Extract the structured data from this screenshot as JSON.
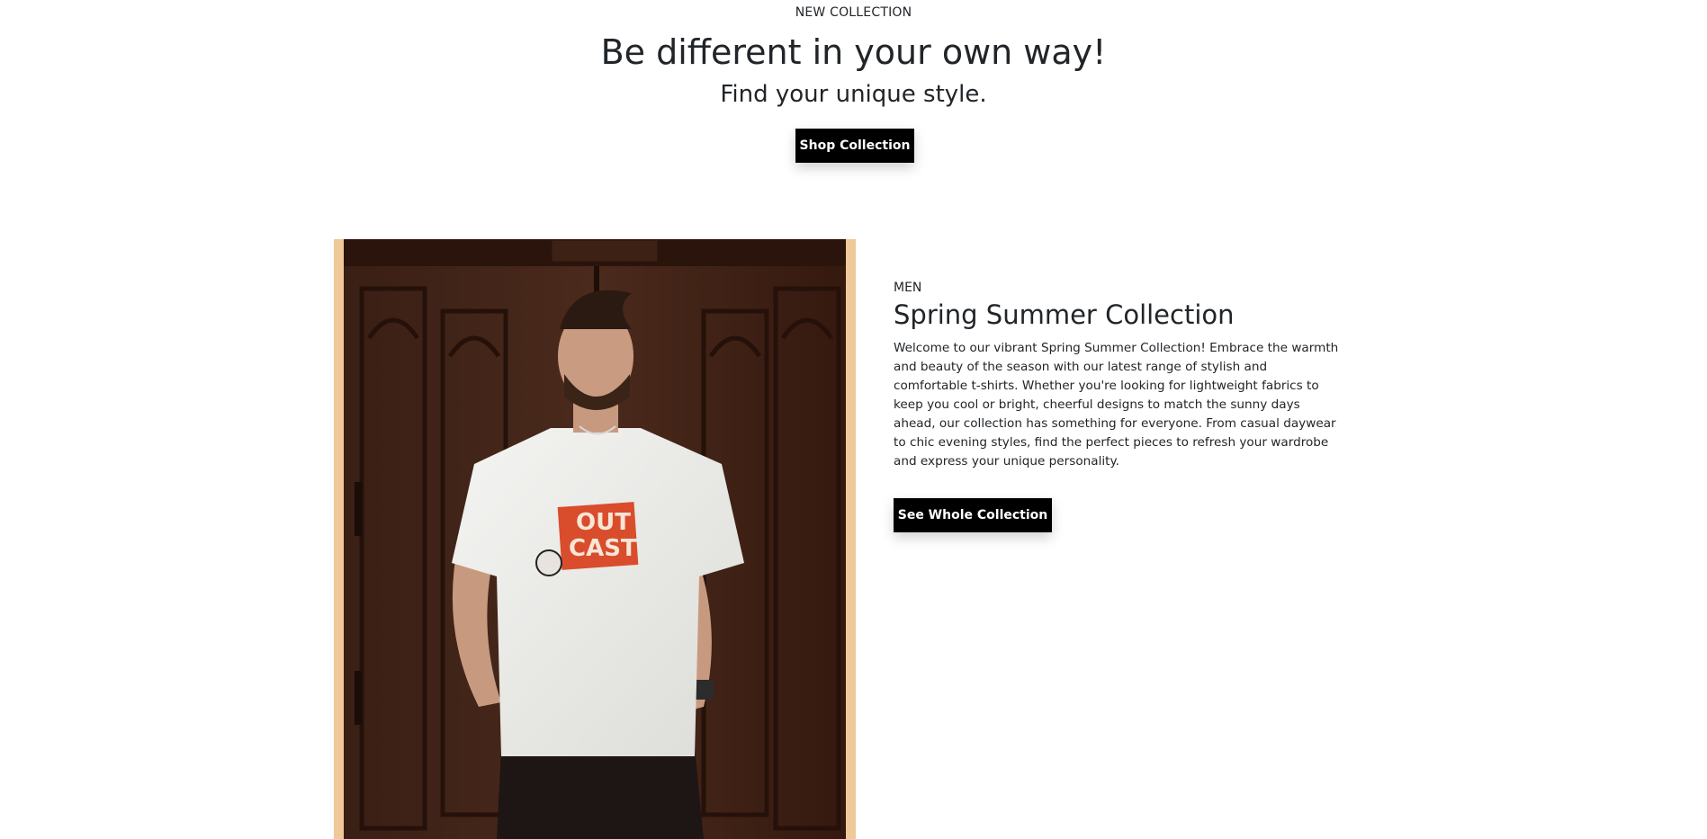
{
  "hero": {
    "eyebrow": "NEW COLLECTION",
    "title": "Be different in your own way!",
    "subtitle": "Find your unique style.",
    "button_label": "Shop Collection"
  },
  "feature": {
    "image_alt": "Man wearing white OUTCAST t-shirt in front of a wooden door",
    "tshirt_print": "OUT CAST",
    "eyebrow": "MEN",
    "title": "Spring Summer Collection",
    "body": "Welcome to our vibrant Spring Summer Collection! Embrace the warmth and beauty of the season with our latest range of stylish and comfortable t-shirts. Whether you're looking for lightweight fabrics to keep you cool or bright, cheerful designs to match the sunny days ahead, our collection has something for everyone. From casual daywear to chic evening styles, find the perfect pieces to refresh your wardrobe and express your unique personality.",
    "button_label": "See Whole Collection"
  },
  "colors": {
    "button_bg": "#000000",
    "button_text": "#ffffff",
    "photo_frame": "#f0c999",
    "text": "#212529"
  }
}
